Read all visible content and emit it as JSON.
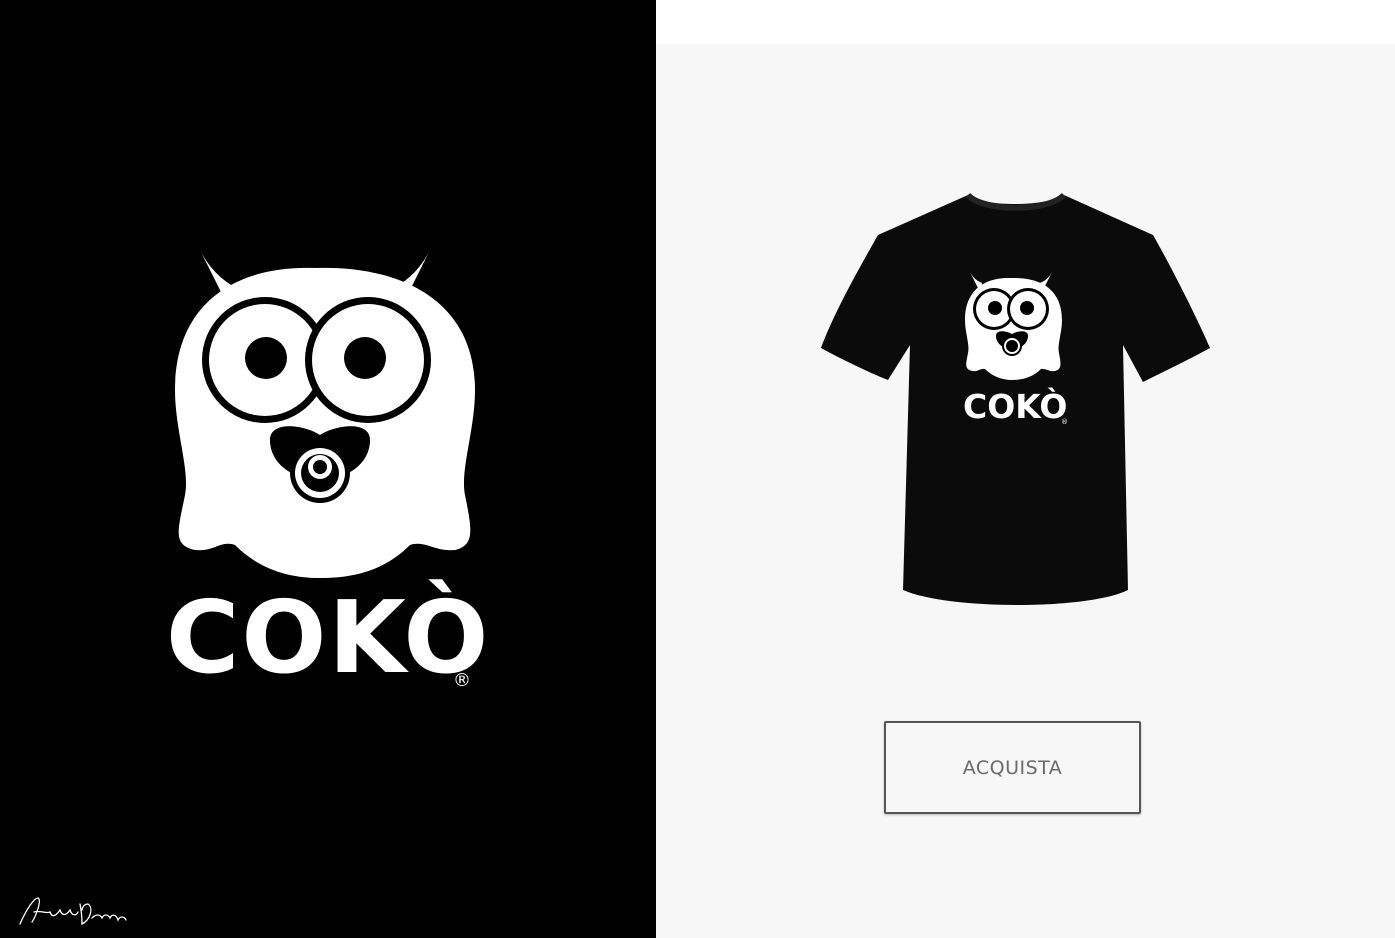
{
  "brand": {
    "name": "COKÒ",
    "registered_mark": "®"
  },
  "product": {
    "print_name": "COKÒ",
    "print_registered_mark": "®"
  },
  "cta": {
    "label": "ACQUISTA"
  },
  "colors": {
    "left_background": "#000000",
    "right_background": "#f7f7f7",
    "logo": "#ffffff",
    "shirt": "#0b0b0b",
    "button_border": "#555555",
    "button_text": "#6a6a6a"
  },
  "icons": {
    "brand_logo": "owl-with-pacifier-logo",
    "signature": "handwritten-signature",
    "product_image": "black-tshirt-with-owl-print"
  }
}
